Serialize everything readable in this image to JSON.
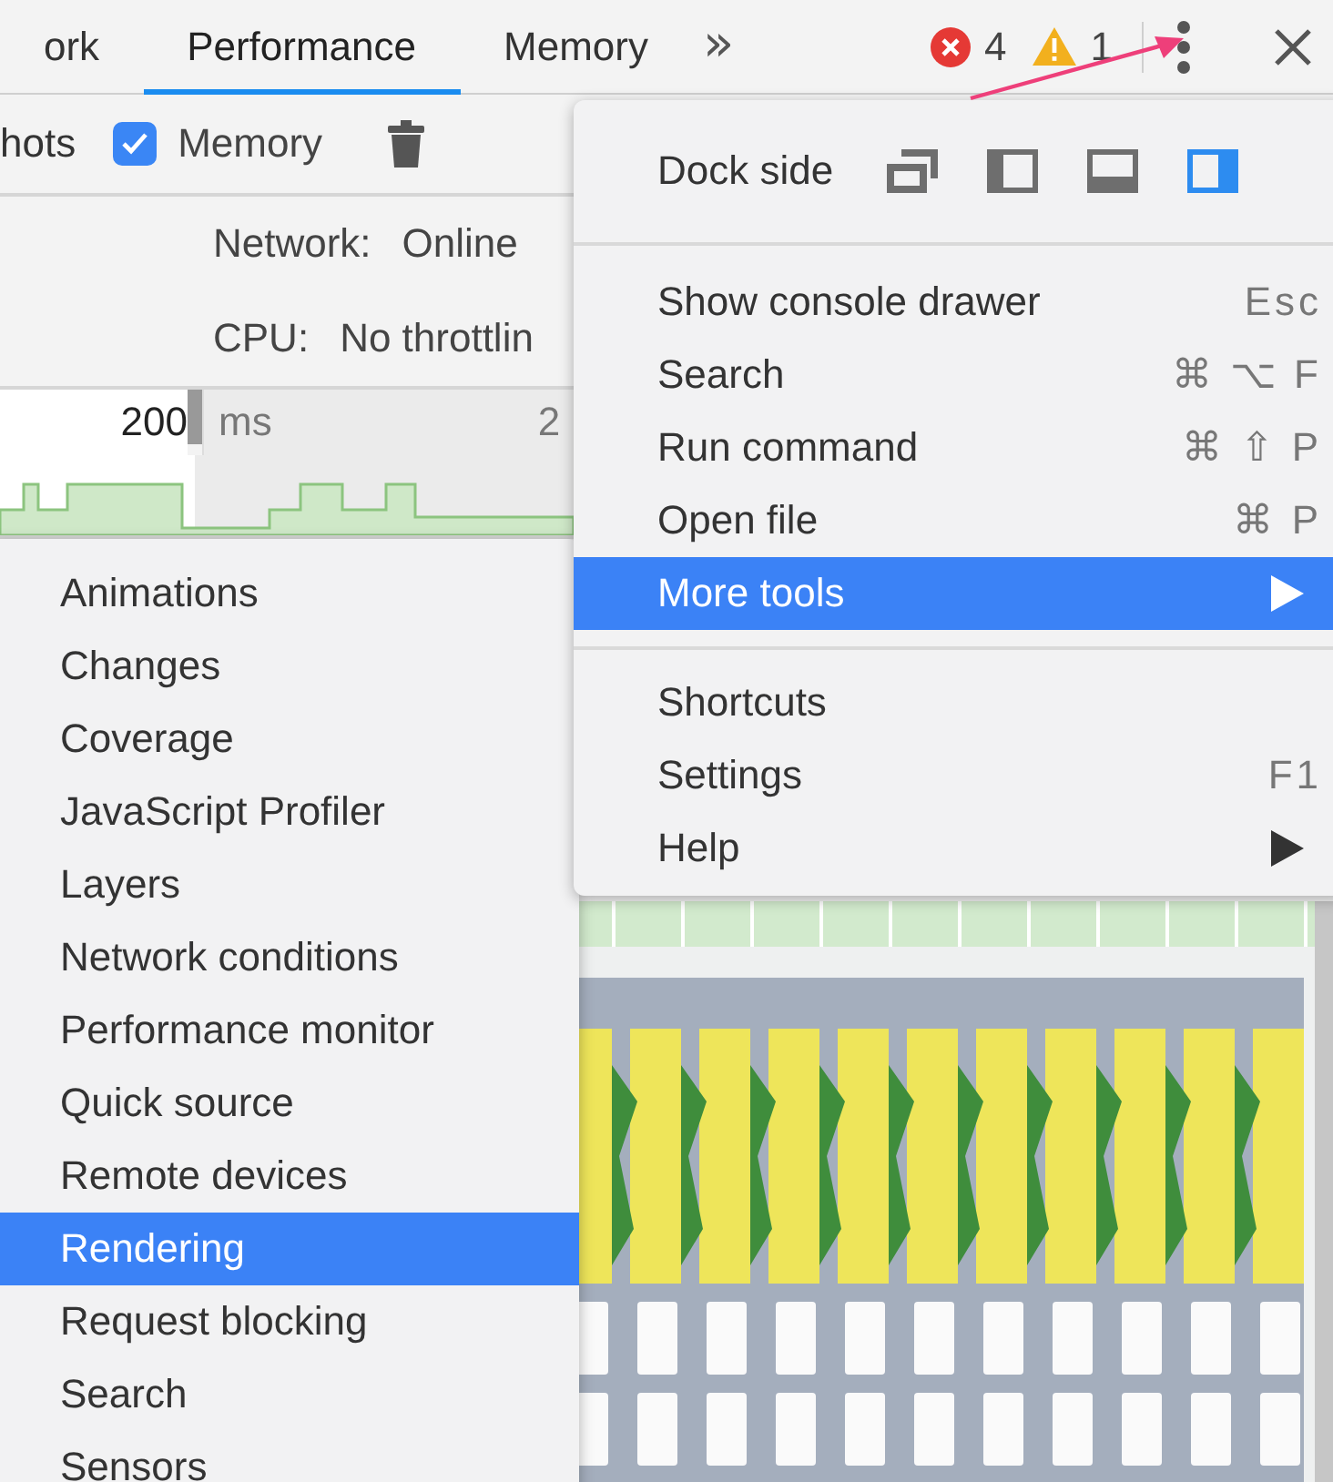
{
  "tabs": [
    {
      "label": "ork",
      "selected": false
    },
    {
      "label": "Performance",
      "selected": true
    },
    {
      "label": "Memory",
      "selected": false
    }
  ],
  "tab_overflow": "»",
  "issues": {
    "errors": "4",
    "warnings": "1"
  },
  "toolbar": {
    "screenshots_label": "hots",
    "memory": {
      "label": "Memory",
      "checked": true
    }
  },
  "throttling": [
    {
      "label": "Network:",
      "value": "Online"
    },
    {
      "label": "CPU:",
      "value": "No throttlin"
    }
  ],
  "overview": {
    "time_label": "200",
    "unit": "ms",
    "next_label": "2"
  },
  "main_menu": {
    "dock_side": {
      "label": "Dock side",
      "options": [
        {
          "kind": "undock",
          "selected": false
        },
        {
          "kind": "left",
          "selected": false
        },
        {
          "kind": "bottom",
          "selected": false
        },
        {
          "kind": "right",
          "selected": true
        }
      ]
    },
    "sections": [
      {
        "items": [
          {
            "label": "Show console drawer",
            "shortcut": "Esc",
            "submenu": false,
            "selected": false
          },
          {
            "label": "Search",
            "shortcut": "⌘ ⌥ F",
            "submenu": false,
            "selected": false
          },
          {
            "label": "Run command",
            "shortcut": "⌘ ⇧ P",
            "submenu": false,
            "selected": false
          },
          {
            "label": "Open file",
            "shortcut": "⌘ P",
            "submenu": false,
            "selected": false
          },
          {
            "label": "More tools",
            "submenu": true,
            "selected": true
          }
        ]
      },
      {
        "items": [
          {
            "label": "Shortcuts",
            "submenu": false,
            "selected": false
          },
          {
            "label": "Settings",
            "shortcut": "F1",
            "submenu": false,
            "selected": false
          },
          {
            "label": "Help",
            "submenu": true,
            "selected": false
          }
        ]
      }
    ]
  },
  "more_tools": {
    "items": [
      {
        "label": "Animations",
        "selected": false
      },
      {
        "label": "Changes",
        "selected": false
      },
      {
        "label": "Coverage",
        "selected": false
      },
      {
        "label": "JavaScript Profiler",
        "selected": false
      },
      {
        "label": "Layers",
        "selected": false
      },
      {
        "label": "Network conditions",
        "selected": false
      },
      {
        "label": "Performance monitor",
        "selected": false
      },
      {
        "label": "Quick source",
        "selected": false
      },
      {
        "label": "Remote devices",
        "selected": false
      },
      {
        "label": "Rendering",
        "selected": true
      },
      {
        "label": "Request blocking",
        "selected": false
      },
      {
        "label": "Search",
        "selected": false
      },
      {
        "label": "Sensors",
        "selected": false
      }
    ]
  }
}
